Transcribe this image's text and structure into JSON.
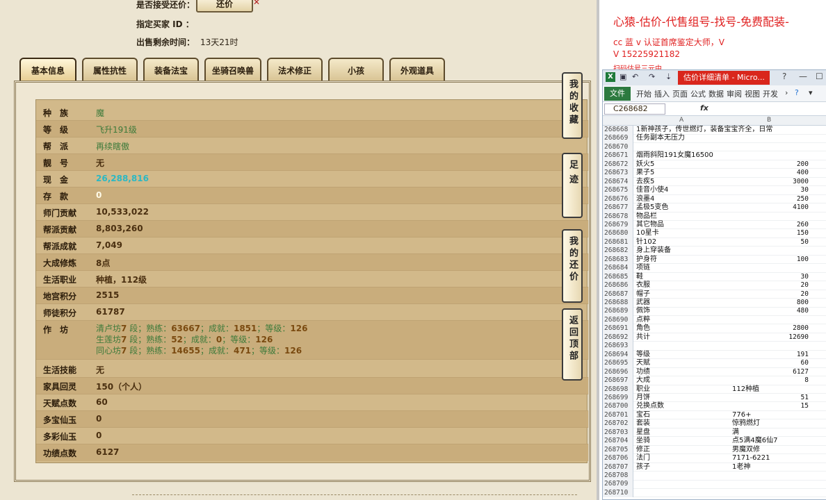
{
  "trade": {
    "accept_offer_label": "是否接受还价：",
    "offer_button": "还价",
    "designated_buyer_label": "指定买家 ID ：",
    "remaining_label": "出售剩余时间：",
    "remaining_value": "13天21时"
  },
  "tabs": [
    "基本信息",
    "属性抗性",
    "装备法宝",
    "坐骑召唤兽",
    "法术修正",
    "小孩",
    "外观道具"
  ],
  "info": {
    "race_label": "种　族",
    "race": "魔",
    "level_label": "等　级",
    "level": "飞升191级",
    "faction_label": "帮　派",
    "faction": "再续瞎傲",
    "pretty_label": "靓　号",
    "pretty": "无",
    "cash_label": "现　金",
    "cash": "26,288,816",
    "deposit_label": "存　款",
    "deposit": "0",
    "school_contrib_label": "师门贡献",
    "school_contrib": "10,533,022",
    "faction_contrib_label": "帮派贡献",
    "faction_contrib": "8,803,260",
    "faction_achieve_label": "帮派成就",
    "faction_achieve": "7,049",
    "dacheng_label": "大成修炼",
    "dacheng": "8点",
    "life_job_label": "生活职业",
    "life_job": "种植，112级",
    "palace_label": "地宫积分",
    "palace": "2515",
    "mentor_label": "师徒积分",
    "mentor": "61787",
    "workshop_label": "作　坊",
    "workshops": [
      {
        "name": "清卢坊",
        "n1": "7",
        "s1": " 段；熟练：",
        "n2": "63667",
        "s2": "；成就：",
        "n3": "1851",
        "s3": "；等级：",
        "n4": "126"
      },
      {
        "name": "生莲坊",
        "n1": "7",
        "s1": " 段；熟练：",
        "n2": "52",
        "s2": "；成就：",
        "n3": "0",
        "s3": "；等级：",
        "n4": "126"
      },
      {
        "name": "同心坊",
        "n1": "7",
        "s1": " 段；熟练：",
        "n2": "14655",
        "s2": "；成就：",
        "n3": "471",
        "s3": "；等级：",
        "n4": "126"
      }
    ],
    "life_skill_label": "生活技能",
    "life_skill": "无",
    "home_label": "家具回灵",
    "home": "150（个人）",
    "talent_label": "天赋点数",
    "talent": "60",
    "duobao_label": "多宝仙玉",
    "duobao": "0",
    "duocai_label": "多彩仙玉",
    "duocai": "0",
    "merit_label": "功绩点数",
    "merit": "6127"
  },
  "side_buttons": [
    "我的收藏",
    "足迹",
    "我的还价",
    "返回顶部"
  ],
  "promo": {
    "title": "心猿-估价-代售组号-找号-免费配装-",
    "line1": "cc 蓝 v 认证首席鉴定大师，V",
    "line2": "V 15225921182",
    "line3": "扫码估号三元中"
  },
  "excel": {
    "doc_title": "估价详细清单 - Micro...",
    "ribbon_tabs": [
      "文件",
      "开始",
      "插入",
      "页面",
      "公式",
      "数据",
      "审阅",
      "视图",
      "开发"
    ],
    "name_box": "C268682",
    "fx": "fx",
    "col_a": "A",
    "col_b": "B",
    "rows": [
      {
        "n": "268668",
        "a": "1新神孩子，传世燃灯，装备宝宝齐全，日常",
        "b": ""
      },
      {
        "n": "268669",
        "a": "任务副本无压力",
        "b": ""
      },
      {
        "n": "268670",
        "a": "",
        "b": ""
      },
      {
        "n": "268671",
        "a": "烟雨斜阳191女魔16500",
        "b": ""
      },
      {
        "n": "268672",
        "a": "妖火5",
        "b": "200"
      },
      {
        "n": "268673",
        "a": "果子5",
        "b": "400"
      },
      {
        "n": "268674",
        "a": "去疾5",
        "b": "3000"
      },
      {
        "n": "268675",
        "a": "佳音小使4",
        "b": "30"
      },
      {
        "n": "268676",
        "a": "浪墨4",
        "b": "250"
      },
      {
        "n": "268677",
        "a": "孟极5变色",
        "b": "4100"
      },
      {
        "n": "268678",
        "a": "物品栏",
        "b": ""
      },
      {
        "n": "268679",
        "a": "其它物品",
        "b": "260"
      },
      {
        "n": "268680",
        "a": "10星卡",
        "b": "150"
      },
      {
        "n": "268681",
        "a": "针102",
        "b": "50"
      },
      {
        "n": "268682",
        "a": "身上穿装备",
        "b": ""
      },
      {
        "n": "268683",
        "a": "护身符",
        "b": "100"
      },
      {
        "n": "268684",
        "a": "项链",
        "b": ""
      },
      {
        "n": "268685",
        "a": "鞋",
        "b": "30"
      },
      {
        "n": "268686",
        "a": "衣服",
        "b": "20"
      },
      {
        "n": "268687",
        "a": "帽子",
        "b": "20"
      },
      {
        "n": "268688",
        "a": "武器",
        "b": "800"
      },
      {
        "n": "268689",
        "a": "佩饰",
        "b": "480"
      },
      {
        "n": "268690",
        "a": "点粹",
        "b": ""
      },
      {
        "n": "268691",
        "a": "角色",
        "b": "2800"
      },
      {
        "n": "268692",
        "a": "共计",
        "b": "12690"
      },
      {
        "n": "268693",
        "a": "",
        "b": ""
      },
      {
        "n": "268694",
        "a": "等级",
        "b": "191"
      },
      {
        "n": "268695",
        "a": "天赋",
        "b": "60"
      },
      {
        "n": "268696",
        "a": "功绩",
        "b": "6127"
      },
      {
        "n": "268697",
        "a": "大成",
        "b": "8"
      },
      {
        "n": "268698",
        "a": "职业",
        "t": "112种植"
      },
      {
        "n": "268699",
        "a": "月饼",
        "b": "51"
      },
      {
        "n": "268700",
        "a": "兑换点数",
        "b": "15"
      },
      {
        "n": "268701",
        "a": "宝石",
        "t": "776+"
      },
      {
        "n": "268702",
        "a": "套装",
        "t": "惊鸦燃灯"
      },
      {
        "n": "268703",
        "a": "星盘",
        "t": "满"
      },
      {
        "n": "268704",
        "a": "坐骑",
        "t": "点5满4魔6仙7"
      },
      {
        "n": "268705",
        "a": "修正",
        "t": "男魔双修"
      },
      {
        "n": "268706",
        "a": "法门",
        "t": "7171-6221"
      },
      {
        "n": "268707",
        "a": "孩子",
        "t": "1老神"
      },
      {
        "n": "268708",
        "a": "",
        "b": ""
      },
      {
        "n": "268709",
        "a": "",
        "b": ""
      },
      {
        "n": "268710",
        "a": "",
        "b": ""
      }
    ]
  }
}
